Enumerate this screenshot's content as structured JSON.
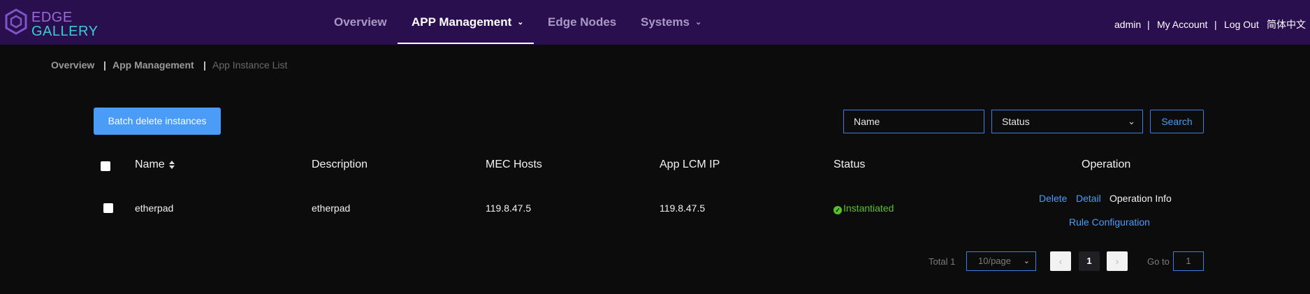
{
  "header": {
    "logo_line1": "EDGE",
    "logo_line2": "GALLERY",
    "nav": [
      {
        "label": "Overview"
      },
      {
        "label": "APP Management"
      },
      {
        "label": "Edge Nodes"
      },
      {
        "label": "Systems"
      }
    ],
    "user": {
      "username": "admin",
      "my_account": "My Account",
      "logout": "Log Out",
      "language": "简体中文",
      "separator": "|"
    }
  },
  "breadcrumb": [
    "Overview",
    "App Management",
    "App Instance List"
  ],
  "toolbar": {
    "batch_delete_label": "Batch delete instances",
    "name_filter_value": "Name",
    "status_filter_value": "Status",
    "search_label": "Search"
  },
  "table": {
    "columns": [
      "Name",
      "Description",
      "MEC Hosts",
      "App LCM IP",
      "Status",
      "Operation"
    ],
    "rows": [
      {
        "name": "etherpad",
        "description": "etherpad",
        "mec_hosts": "119.8.47.5",
        "app_lcm_ip": "119.8.47.5",
        "status": "Instantiated",
        "operations": {
          "delete": "Delete",
          "detail": "Detail",
          "operation_info": "Operation Info",
          "rule_configuration": "Rule Configuration"
        }
      }
    ]
  },
  "pagination": {
    "total_label": "Total 1",
    "page_size": "10/page",
    "current_page": "1",
    "goto_label": "Go to",
    "goto_value": "1"
  },
  "colors": {
    "topbar": "#2a0f4f",
    "accent": "#4a9cf6",
    "status_ok": "#58c22c"
  },
  "icons": [
    "edge-gallery-logo-icon",
    "chevron-down-icon",
    "sort-icon",
    "check-circle-icon",
    "chevron-left-icon",
    "chevron-right-icon"
  ]
}
